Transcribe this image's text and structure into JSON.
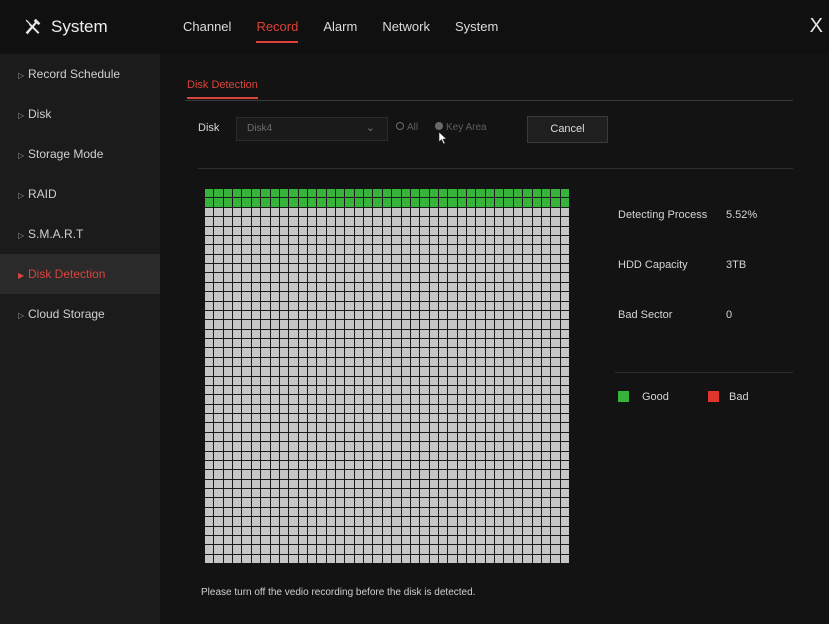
{
  "app": {
    "title": "System",
    "icon": "tools-icon"
  },
  "top_nav": [
    {
      "label": "Channel",
      "active": false
    },
    {
      "label": "Record",
      "active": true
    },
    {
      "label": "Alarm",
      "active": false
    },
    {
      "label": "Network",
      "active": false
    },
    {
      "label": "System",
      "active": false
    }
  ],
  "close_label": "X",
  "sidebar": [
    {
      "label": "Record Schedule",
      "active": false
    },
    {
      "label": "Disk",
      "active": false
    },
    {
      "label": "Storage Mode",
      "active": false
    },
    {
      "label": "RAID",
      "active": false
    },
    {
      "label": "S.M.A.R.T",
      "active": false
    },
    {
      "label": "Disk Detection",
      "active": true
    },
    {
      "label": "Cloud Storage",
      "active": false
    }
  ],
  "subtab": "Disk Detection",
  "controls": {
    "disk_label": "Disk",
    "disk_value": "Disk4",
    "radio_all": "All",
    "radio_key_area": "Key Area",
    "selected_radio": "Key Area",
    "cancel": "Cancel"
  },
  "grid": {
    "columns": 39,
    "rows": 40,
    "good_rows": 2,
    "bad_count": 0
  },
  "stats": {
    "process_label": "Detecting Process",
    "process_value": "5.52%",
    "capacity_label": "HDD Capacity",
    "capacity_value": "3TB",
    "bad_label": "Bad Sector",
    "bad_value": "0"
  },
  "legend": {
    "good_label": "Good",
    "good_color": "#36b33a",
    "bad_label": "Bad",
    "bad_color": "#e0352d"
  },
  "notice": "Please turn off the vedio recording before the disk is detected.",
  "colors": {
    "accent": "#e0403a",
    "background": "#131313",
    "sidebar": "#1b1b1b",
    "block": "#c6c6c6"
  }
}
